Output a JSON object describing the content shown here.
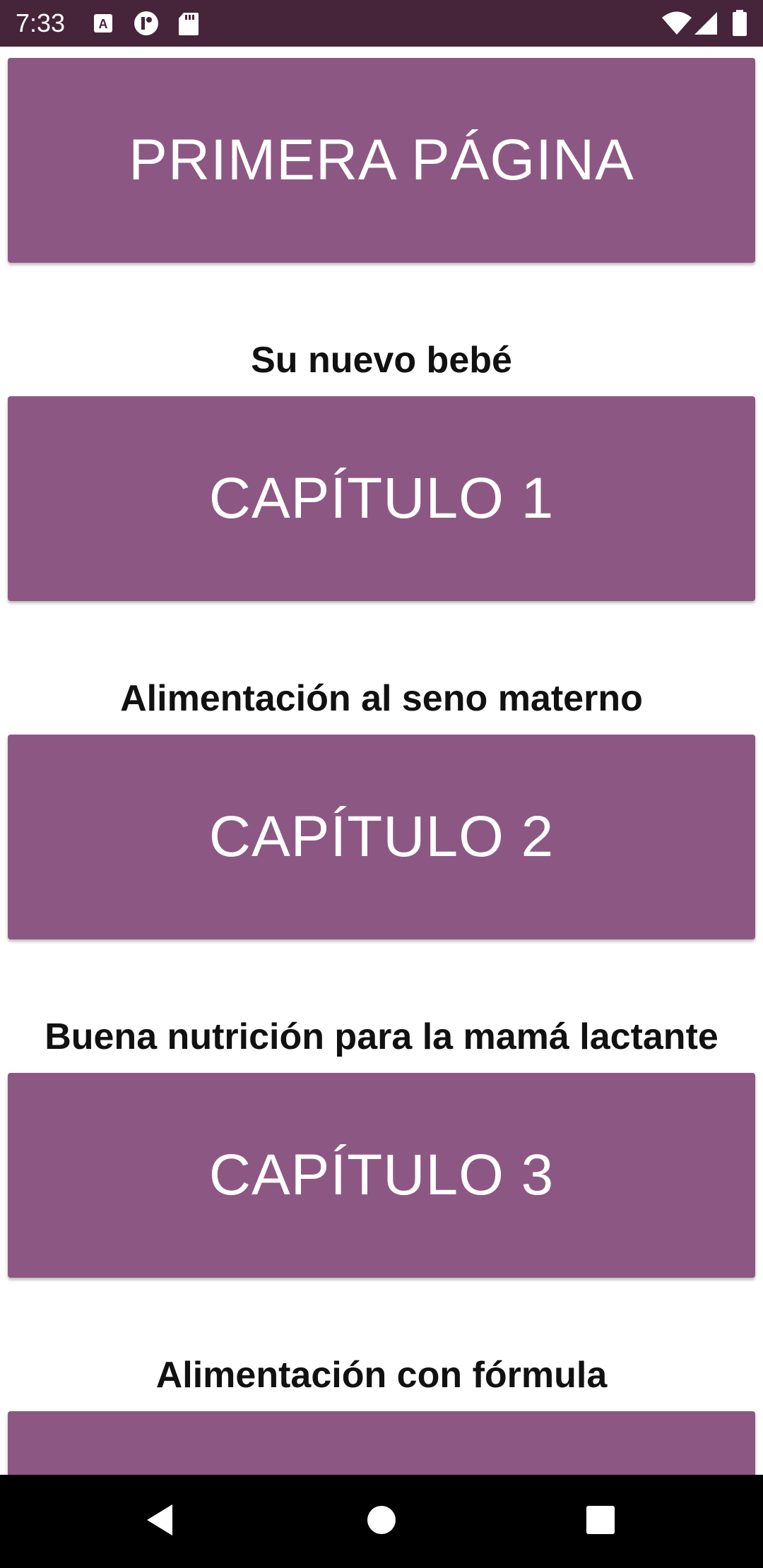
{
  "status_bar": {
    "time": "7:33",
    "left_icons": [
      "keyboard-a-icon",
      "notification-app-icon",
      "sd-card-icon"
    ],
    "right_icons": [
      "wifi-icon",
      "cellular-signal-icon",
      "battery-icon"
    ]
  },
  "colors": {
    "status_bar_bg": "#46243a",
    "button_bg": "#8c5883",
    "button_text": "#ffffff",
    "subtitle_text": "#111111",
    "nav_bar_bg": "#000000"
  },
  "sections": [
    {
      "button_label": "PRIMERA PÁGINA",
      "subtitle": "Su nuevo bebé"
    },
    {
      "button_label": "CAPÍTULO 1",
      "subtitle": "Alimentación al seno materno"
    },
    {
      "button_label": "CAPÍTULO 2",
      "subtitle": "Buena nutrición para la mamá lactante"
    },
    {
      "button_label": "CAPÍTULO 3",
      "subtitle": "Alimentación con fórmula"
    },
    {
      "button_label": ""
    }
  ],
  "nav_bar": {
    "icons": [
      "back-icon",
      "home-icon",
      "recents-icon"
    ]
  }
}
